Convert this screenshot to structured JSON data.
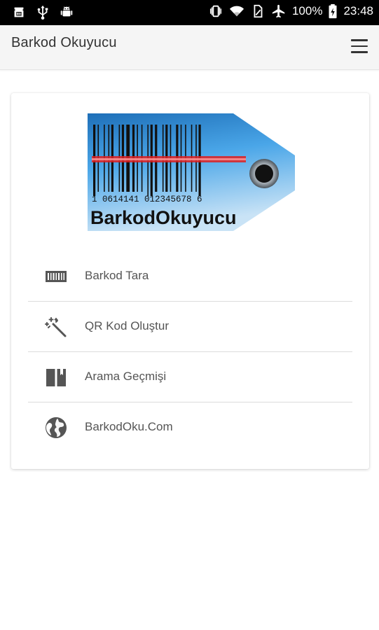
{
  "status_bar": {
    "battery": "100%",
    "time": "23:48"
  },
  "app_bar": {
    "title": "Barkod Okuyucu"
  },
  "logo": {
    "digits": "1  0614141  012345678  6",
    "brand": "BarkodOkuyucu"
  },
  "menu": [
    {
      "label": "Barkod Tara",
      "icon": "barcode-icon"
    },
    {
      "label": "QR Kod Oluştur",
      "icon": "magic-wand-icon"
    },
    {
      "label": "Arama Geçmişi",
      "icon": "book-icon"
    },
    {
      "label": "BarkodOku.Com",
      "icon": "globe-icon"
    }
  ],
  "colors": {
    "status_bar_bg": "#000000",
    "app_bar_bg": "#f5f5f5",
    "tag_blue": "#2f8fd6",
    "scan_line": "#e02020"
  }
}
